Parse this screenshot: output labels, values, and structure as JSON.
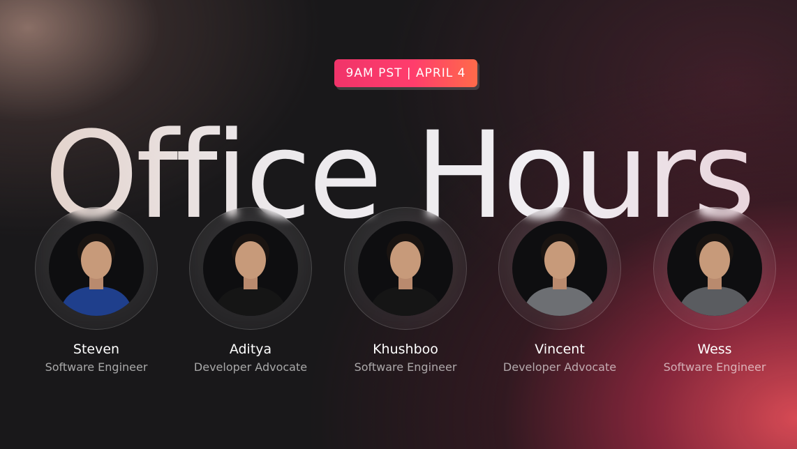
{
  "event": {
    "date_time": "9AM PST | APRIL 4",
    "title": "Office Hours"
  },
  "team": [
    {
      "name": "Steven",
      "role": "Software Engineer",
      "shirt": "#1f3f8c",
      "icon": "person-photo"
    },
    {
      "name": "Aditya",
      "role": "Developer Advocate",
      "shirt": "#151515",
      "icon": "person-photo"
    },
    {
      "name": "Khushboo",
      "role": "Software Engineer",
      "shirt": "#151515",
      "icon": "person-photo"
    },
    {
      "name": "Vincent",
      "role": "Developer Advocate",
      "shirt": "#6d6f73",
      "icon": "person-photo"
    },
    {
      "name": "Wess",
      "role": "Software Engineer",
      "shirt": "#5a5c60",
      "icon": "person-photo"
    }
  ],
  "colors": {
    "badge_start": "#f0346a",
    "badge_end": "#ff6a4a",
    "background": "#19181a",
    "glow": "#d64a54"
  }
}
